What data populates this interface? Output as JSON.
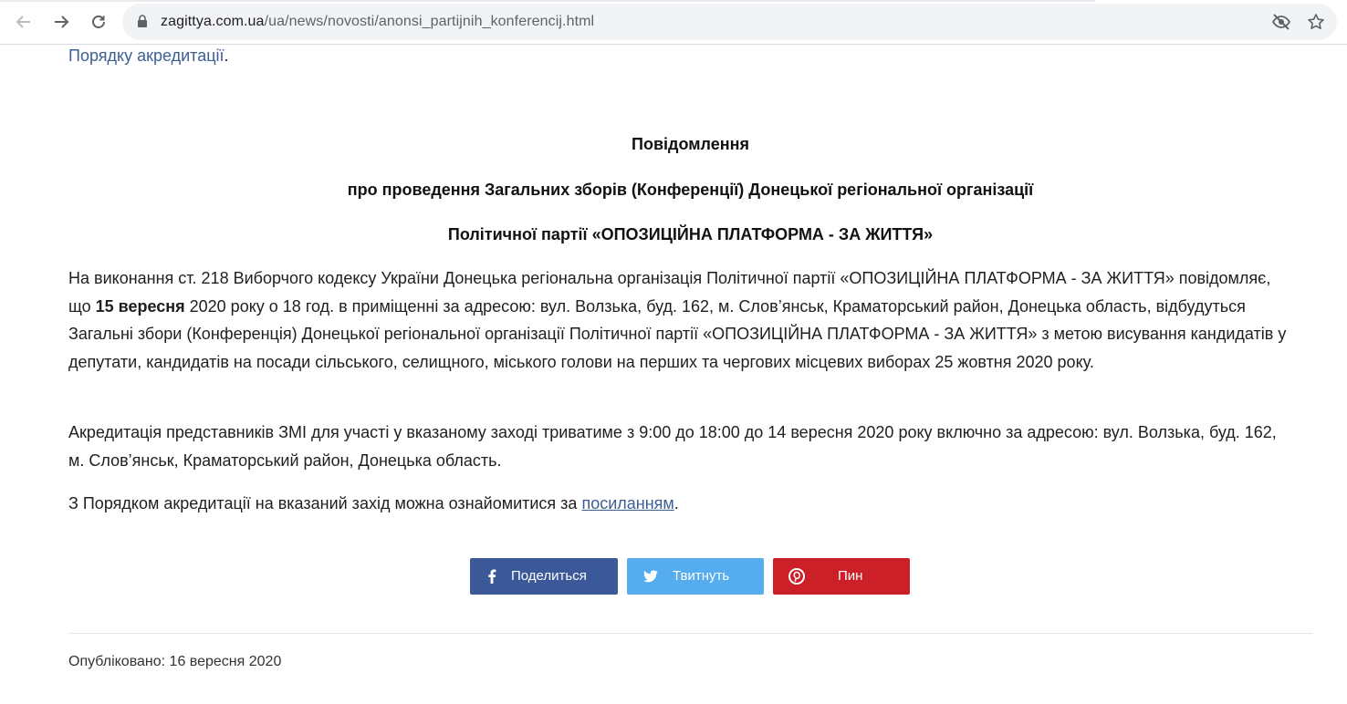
{
  "browser": {
    "url_host": "zagittya.com.ua",
    "url_path": "/ua/news/novosti/anonsi_partijnih_konferencij.html",
    "icons": [
      "back-icon",
      "forward-icon",
      "reload-icon",
      "lock-icon",
      "eye-off-icon",
      "star-icon"
    ]
  },
  "article": {
    "prev_link": "Порядку акредитації",
    "prev_tail": ".",
    "heading1": "Повідомлення",
    "heading2": "про проведення Загальних зборів (Конференції) Донецької регіональної організації",
    "heading3": "Політичної партії «ОПОЗИЦІЙНА ПЛАТФОРМА - ЗА ЖИТТЯ»",
    "p1_a": "На виконання ст. 218 Виборчого кодексу України Донецька регіональна організація Політичної партії «ОПОЗИЦІЙНА ПЛАТФОРМА - ЗА ЖИТТЯ» повідомляє, що ",
    "p1_bold": "15 вересня",
    "p1_b": " 2020 року о 18 год. в приміщенні за адресою: вул. Волзька, буд. 162, м. Слов’янськ, Краматорський район, Донецька область, відбудуться Загальні збори (Конференція) Донецької регіональної організації Політичної партії «ОПОЗИЦІЙНА ПЛАТФОРМА - ЗА ЖИТТЯ» з метою висування кандидатів у депутати, кандидатів на посади сільського, селищного, міського голови на перших та чергових місцевих виборах 25 жовтня 2020 року.",
    "p2": "Акредитація представників ЗМІ для участі у вказаному заході триватиме з 9:00 до 18:00 до 14 вересня 2020 року включно за адресою: вул. Волзька, буд. 162, м. Слов’янськ, Краматорський район, Донецька область.",
    "p3_a": "З Порядком акредитації на вказаний захід можна ознайомитися за ",
    "p3_link": "посиланням",
    "p3_b": "."
  },
  "share": {
    "facebook": {
      "label": "Поделиться",
      "color": "#3b5998",
      "icon": "facebook-icon"
    },
    "twitter": {
      "label": "Твитнуть",
      "color": "#55acee",
      "icon": "twitter-icon"
    },
    "pinterest": {
      "label": "Пин",
      "color": "#cb2027",
      "icon": "pinterest-icon"
    }
  },
  "footer": {
    "published": "Опубліковано: 16 вересня 2020"
  }
}
